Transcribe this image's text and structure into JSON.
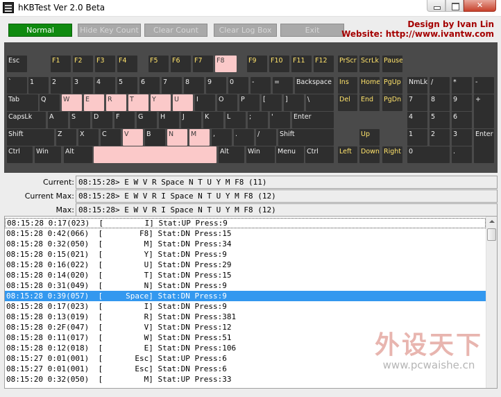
{
  "window": {
    "title": "hKBTest Ver 2.0 Beta"
  },
  "toolbar": {
    "normal": "Normal",
    "hide_key_count": "Hide Key Count",
    "clear_count": "Clear Count",
    "clear_log_box": "Clear Log Box",
    "exit": "Exit"
  },
  "credits": {
    "design": "Design by Ivan Lin",
    "website": "Website: http://www.ivantw.com"
  },
  "keyboard": {
    "highlight_color": "#fbc9c9",
    "keys": {
      "esc": "Esc",
      "f1": "F1",
      "f2": "F2",
      "f3": "F3",
      "f4": "F4",
      "f5": "F5",
      "f6": "F6",
      "f7": "F7",
      "f8": "F8",
      "f9": "F9",
      "f10": "F10",
      "f11": "F11",
      "f12": "F12",
      "prscr": "PrScr",
      "scrlk": "ScrLk",
      "pause": "Pause",
      "backtick": "`",
      "k1": "1",
      "k2": "2",
      "k3": "3",
      "k4": "4",
      "k5": "5",
      "k6": "6",
      "k7": "7",
      "k8": "8",
      "k9": "9",
      "k0": "0",
      "minus": "-",
      "equal": "=",
      "backspace": "Backspace",
      "ins": "Ins",
      "home": "Home",
      "pgup": "PgUp",
      "numlk": "NmLk",
      "np_div": "/",
      "np_mul": "*",
      "np_sub": "-",
      "tab": "Tab",
      "q": "Q",
      "w": "W",
      "e": "E",
      "r": "R",
      "t": "T",
      "y": "Y",
      "u": "U",
      "i": "I",
      "o": "O",
      "p": "P",
      "lbracket": "[",
      "rbracket": "]",
      "backslash": "\\",
      "del": "Del",
      "end": "End",
      "pgdn": "PgDn",
      "np7": "7",
      "np8": "8",
      "np9": "9",
      "np_add": "+",
      "capslk": "CapsLk",
      "a": "A",
      "s": "S",
      "d": "D",
      "f": "F",
      "g": "G",
      "h": "H",
      "j": "J",
      "k": "K",
      "l": "L",
      "semicolon": ";",
      "quote": "'",
      "enter": "Enter",
      "np4": "4",
      "np5": "5",
      "np6": "6",
      "lshift": "Shift",
      "z": "Z",
      "x": "X",
      "c": "C",
      "v": "V",
      "b": "B",
      "n": "N",
      "m": "M",
      "comma": ",",
      "period": ".",
      "slash": "/",
      "rshift": "Shift",
      "up": "Up",
      "np1": "1",
      "np2": "2",
      "np3": "3",
      "np_enter": "Enter",
      "lctrl": "Ctrl",
      "lwin": "Win",
      "lalt": "Alt",
      "space": "",
      "ralt": "Alt",
      "rwin": "Win",
      "menu": "Menu",
      "rctrl": "Ctrl",
      "left": "Left",
      "down": "Down",
      "right": "Right",
      "np0": "0",
      "np_dot": "."
    }
  },
  "status": {
    "current_label": "Current:",
    "current_value": "08:15:28> E W V R Space N T U Y M F8 (11)",
    "current_max_label": "Current Max:",
    "current_max_value": "08:15:28> E W V R I Space N T U Y M F8 (12)",
    "max_label": "Max:",
    "max_value": "08:15:28> E W V R I Space N T U Y M F8 (12)"
  },
  "log": {
    "rows": [
      "08:15:28 0:17(023)  [         I] Stat:UP Press:9",
      "08:15:28 0:42(066)  [        F8] Stat:DN Press:15",
      "08:15:28 0:32(050)  [         M] Stat:DN Press:34",
      "08:15:28 0:15(021)  [         Y] Stat:DN Press:9",
      "08:15:28 0:16(022)  [         U] Stat:DN Press:29",
      "08:15:28 0:14(020)  [         T] Stat:DN Press:15",
      "08:15:28 0:31(049)  [         N] Stat:DN Press:9",
      "08:15:28 0:39(057)  [     Space] Stat:DN Press:9",
      "08:15:28 0:17(023)  [         I] Stat:DN Press:9",
      "08:15:28 0:13(019)  [         R] Stat:DN Press:381",
      "08:15:28 0:2F(047)  [         V] Stat:DN Press:12",
      "08:15:28 0:11(017)  [         W] Stat:DN Press:51",
      "08:15:28 0:12(018)  [         E] Stat:DN Press:106",
      "08:15:27 0:01(001)  [       Esc] Stat:UP Press:6",
      "08:15:27 0:01(001)  [       Esc] Stat:DN Press:6",
      "08:15:20 0:32(050)  [         M] Stat:UP Press:33"
    ],
    "selected_index": 7
  },
  "watermark": {
    "text": "外设天下",
    "url": "www.pcwaishe.cn"
  }
}
